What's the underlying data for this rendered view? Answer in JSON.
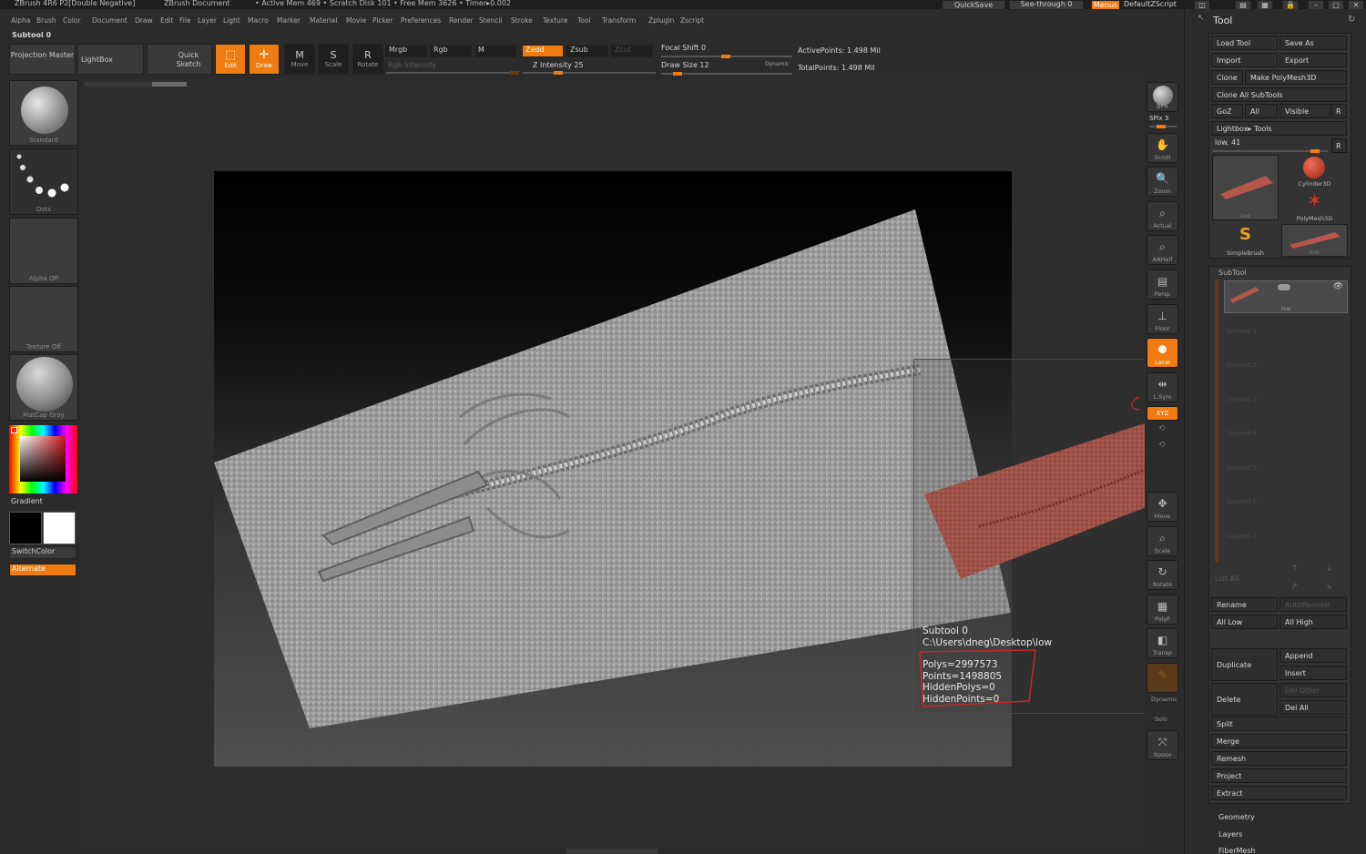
{
  "titlebar": {
    "app": "ZBrush 4R6 P2[Double Negative]",
    "document": "ZBrush Document",
    "stats": "• Active Mem 469 • Scratch Disk 101 • Free Mem 3626 • Timer▸0.002",
    "quicksave": "QuickSave",
    "see_through": "See-through  0",
    "menus": "Menus",
    "script": "DefaultZScript"
  },
  "menubar": [
    "Alpha",
    "Brush",
    "Color",
    "Document",
    "Draw",
    "Edit",
    "File",
    "Layer",
    "Light",
    "Macro",
    "Marker",
    "Material",
    "Movie",
    "Picker",
    "Preferences",
    "Render",
    "Stencil",
    "Stroke",
    "Texture",
    "Tool",
    "Transform",
    "Zplugin",
    "Zscript"
  ],
  "subtool_label": "Subtool 0",
  "toolbar": {
    "projection_master": "Projection Master",
    "lightbox": "LightBox",
    "quick_sketch": "Quick Sketch",
    "edit": "Edit",
    "draw": "Draw",
    "move": "Move",
    "scale": "Scale",
    "rotate": "Rotate",
    "mrgb": "Mrgb",
    "rgb": "Rgb",
    "m": "M",
    "rgb_intensity": "Rgb Intensity",
    "zadd": "Zadd",
    "zsub": "Zsub",
    "zcut": "Zcut",
    "z_intensity": "Z Intensity 25",
    "z_intensity_value": 25,
    "focal_shift": "Focal Shift 0",
    "draw_size": "Draw Size 12",
    "draw_size_value": 12,
    "dynamic": "Dynamic",
    "active_points": "ActivePoints: 1.498 Mil",
    "total_points": "TotalPoints: 1.498 Mil"
  },
  "left_shelf": {
    "brush": "Standard",
    "stroke": "Dots",
    "alpha": "Alpha Off",
    "texture": "Texture Off",
    "material": "MatCap Gray",
    "gradient": "Gradient",
    "switch_color": "SwitchColor",
    "alternate": "Alternate"
  },
  "right_shelf": {
    "bpr": "BPR",
    "spix": "SPix 3",
    "scroll": "Scroll",
    "zoom": "Zoom",
    "actual": "Actual",
    "aahalf": "AAHalf",
    "persp": "Persp",
    "floor": "Floor",
    "local": "Local",
    "lsym": "L.Sym",
    "xyz": "XYZ",
    "move": "Move",
    "scale": "Scale",
    "rotate": "Rotate",
    "polyf": "PolyF",
    "transp": "Transp",
    "dynamic": "Dynamic",
    "solo": "Solo",
    "xpose": "Xpose"
  },
  "info": {
    "subtool": "Subtool 0",
    "path": "C:\\Users\\dneg\\Desktop\\low",
    "polys": "Polys=2997573",
    "points": "Points=1498805",
    "hidden_polys": "HiddenPolys=0",
    "hidden_points": "HiddenPoints=0"
  },
  "tool_panel": {
    "title": "Tool",
    "load_tool": "Load Tool",
    "save_as": "Save As",
    "import": "Import",
    "export": "Export",
    "clone": "Clone",
    "make_polymesh": "Make PolyMesh3D",
    "clone_all": "Clone All SubTools",
    "goz": "GoZ",
    "all": "All",
    "visible": "Visible",
    "r": "R",
    "lightbox_tools": "Lightbox▸ Tools",
    "low_slider": "low. 41",
    "low_value": 41,
    "tools": [
      "low",
      "Cylinder3D",
      "PolyMesh3D",
      "SimpleBrush",
      "low"
    ],
    "subtool_header": "SubTool",
    "subtool_item": "low",
    "unused": [
      "Unused 1",
      "Unused 2",
      "Unused 3",
      "Unused 4",
      "Unused 5",
      "Unused 6",
      "Unused 7"
    ],
    "list_all": "List All",
    "rename": "Rename",
    "auto_reorder": "AutoReorder",
    "all_low": "All Low",
    "all_high": "All High",
    "duplicate": "Duplicate",
    "append": "Append",
    "insert": "Insert",
    "delete": "Delete",
    "del_other": "Del Other",
    "del_all": "Del All",
    "split": "Split",
    "merge": "Merge",
    "remesh": "Remesh",
    "project": "Project",
    "extract": "Extract",
    "geometry": "Geometry",
    "layers": "Layers",
    "fibermesh": "FiberMesh"
  },
  "colors": {
    "accent": "#f07b10",
    "bg": "#2b2b2b",
    "annotation": "#e0242a"
  }
}
